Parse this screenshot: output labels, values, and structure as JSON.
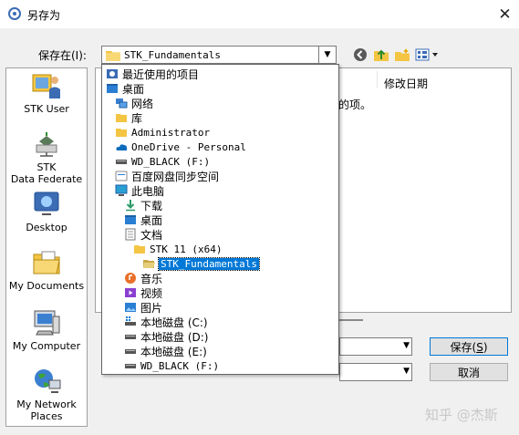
{
  "window": {
    "title": "另存为",
    "close_glyph": "✕"
  },
  "savein": {
    "label": "保存在(I):",
    "value": "STK_Fundamentals"
  },
  "toolbar": {
    "icons": [
      "back-icon",
      "up-folder-icon",
      "new-folder-icon",
      "view-menu-icon"
    ]
  },
  "places": [
    {
      "name": "stk-user",
      "label": "STK User",
      "icon": "user-icon"
    },
    {
      "name": "stk-data-federate",
      "label": "STK\nData Federate",
      "icon": "network-share-icon"
    },
    {
      "name": "desktop",
      "label": "Desktop",
      "icon": "desktop-icon"
    },
    {
      "name": "my-documents",
      "label": "My Documents",
      "icon": "documents-icon"
    },
    {
      "name": "my-computer",
      "label": "My Computer",
      "icon": "computer-icon"
    },
    {
      "name": "my-network-places",
      "label": "My Network\nPlaces",
      "icon": "globe-icon"
    }
  ],
  "filelist": {
    "column_date": "修改日期",
    "hint_fragment": "的项。"
  },
  "buttons": {
    "save": "保存(S)",
    "save_prefix": "保存(",
    "save_key": "S",
    "save_suffix": ")",
    "cancel": "取消"
  },
  "dropdown": {
    "items": [
      {
        "label": "最近使用的项目",
        "indent": 0,
        "icon": "recent-icon",
        "mono": false
      },
      {
        "label": "桌面",
        "indent": 0,
        "icon": "desktop-folder-icon",
        "mono": false
      },
      {
        "label": "网络",
        "indent": 1,
        "icon": "network-icon",
        "mono": false
      },
      {
        "label": "库",
        "indent": 1,
        "icon": "library-icon",
        "mono": false
      },
      {
        "label": "Administrator",
        "indent": 1,
        "icon": "user-folder-icon",
        "mono": true
      },
      {
        "label": "OneDrive - Personal",
        "indent": 1,
        "icon": "onedrive-icon",
        "mono": true
      },
      {
        "label": "WD_BLACK (F:)",
        "indent": 1,
        "icon": "drive-icon",
        "mono": true
      },
      {
        "label": "百度网盘同步空间",
        "indent": 1,
        "icon": "cloud-drive-icon",
        "mono": false
      },
      {
        "label": "此电脑",
        "indent": 1,
        "icon": "this-pc-icon",
        "mono": false
      },
      {
        "label": "下载",
        "indent": 2,
        "icon": "download-icon",
        "mono": false
      },
      {
        "label": "桌面",
        "indent": 2,
        "icon": "desktop-folder-icon",
        "mono": false
      },
      {
        "label": "文档",
        "indent": 2,
        "icon": "document-icon",
        "mono": false
      },
      {
        "label": "STK 11 (x64)",
        "indent": 3,
        "icon": "folder-icon",
        "mono": true
      },
      {
        "label": "STK_Fundamentals",
        "indent": 4,
        "icon": "open-folder-icon",
        "mono": true,
        "selected": true
      },
      {
        "label": "音乐",
        "indent": 2,
        "icon": "music-icon",
        "mono": false
      },
      {
        "label": "视频",
        "indent": 2,
        "icon": "video-icon",
        "mono": false
      },
      {
        "label": "图片",
        "indent": 2,
        "icon": "picture-icon",
        "mono": false
      },
      {
        "label": "本地磁盘 (C:)",
        "indent": 2,
        "icon": "system-drive-icon",
        "mono": false
      },
      {
        "label": "本地磁盘 (D:)",
        "indent": 2,
        "icon": "drive-icon",
        "mono": false
      },
      {
        "label": "本地磁盘 (E:)",
        "indent": 2,
        "icon": "drive-icon",
        "mono": false
      },
      {
        "label": "WD_BLACK (F:)",
        "indent": 2,
        "icon": "drive-icon",
        "mono": true
      }
    ]
  },
  "watermark": "知乎 @杰斯",
  "colors": {
    "selection": "#0078d7",
    "folder": "#f4c542",
    "accent_border": "#0078d7"
  }
}
